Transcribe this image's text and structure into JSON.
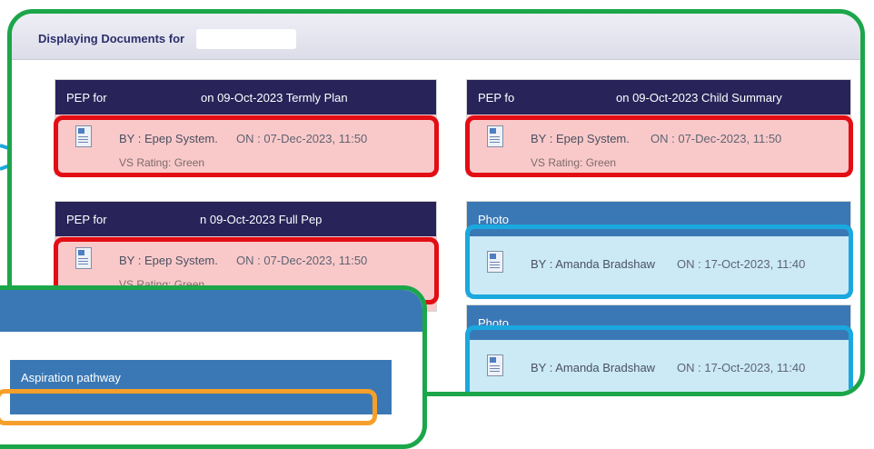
{
  "header": {
    "label": "Displaying Documents for"
  },
  "cards": [
    {
      "title_a": "PEP for",
      "title_b": "on 09-Oct-2023 Termly Plan",
      "by": "BY : Epep System.",
      "on": "ON : 07-Dec-2023, 11:50",
      "rating": "VS Rating: Green"
    },
    {
      "title_a": "PEP fo",
      "title_b": "on 09-Oct-2023 Child Summary",
      "by": "BY : Epep System.",
      "on": "ON : 07-Dec-2023, 11:50",
      "rating": "VS Rating: Green"
    },
    {
      "title_a": "PEP for",
      "title_b": "n 09-Oct-2023 Full Pep",
      "by": "BY : Epep System.",
      "on": "ON : 07-Dec-2023, 11:50",
      "rating": "VS Rating: Green"
    },
    {
      "title_a": "Photo",
      "by": "BY : Amanda Bradshaw",
      "on": "ON : 17-Oct-2023, 11:40"
    },
    {
      "title_a": "Photo",
      "by": "BY : Amanda Bradshaw",
      "on": "ON : 17-Oct-2023, 11:40"
    }
  ],
  "overlay": {
    "aspiration_title": "Aspiration pathway"
  },
  "colors": {
    "highlight_red": "#e30d14",
    "highlight_cyan": "#1aa8de",
    "highlight_green": "#1ca64a",
    "highlight_orange": "#f6a02b",
    "header_dark": "#282359",
    "header_blue": "#3a78b5"
  }
}
